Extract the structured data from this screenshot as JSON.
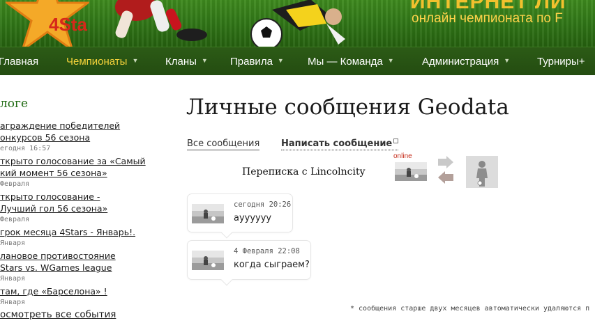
{
  "banner": {
    "star_text": "4Sta",
    "brand_text": "ИНТЕРНЕТ ЛИ",
    "tagline": "онлайн чемпионата по F"
  },
  "nav": {
    "items": [
      {
        "label": "Главная",
        "has_caret": false,
        "active": false
      },
      {
        "label": "Чемпионаты",
        "has_caret": true,
        "active": true
      },
      {
        "label": "Кланы",
        "has_caret": true,
        "active": false
      },
      {
        "label": "Правила",
        "has_caret": true,
        "active": false
      },
      {
        "label": "Мы — Команда",
        "has_caret": true,
        "active": false
      },
      {
        "label": "Администрация",
        "has_caret": true,
        "active": false
      },
      {
        "label": "Турниры+",
        "has_caret": false,
        "active": false
      }
    ]
  },
  "sidebar": {
    "title": "логе",
    "items": [
      {
        "lines": [
          "аграждение победителей",
          "онкурсов 56 сезона"
        ],
        "date": "егодня 16:57"
      },
      {
        "lines": [
          "ткрыто голосование за «Самый",
          "кий момент 56 сезона»"
        ],
        "date": "Февраля"
      },
      {
        "lines": [
          "ткрыто голосование -",
          "Лучший гол 56 сезона»"
        ],
        "date": "Февраля"
      },
      {
        "lines": [
          "грок месяца 4Stars - Январь!."
        ],
        "date": "Января"
      },
      {
        "lines": [
          "лановое противостояние",
          "Stars vs. WGames league"
        ],
        "date": "Января"
      },
      {
        "lines": [
          "там, где «Барселона» !"
        ],
        "date": "Января"
      }
    ],
    "all_events": "осмотреть все события"
  },
  "main": {
    "title": "Личные сообщения Geodata",
    "tab_all": "Все сообщения",
    "tab_write": "Написать сообщение",
    "conversation_title": "Переписка с Lincolncity",
    "online_label": "online",
    "messages": [
      {
        "time": "сегодня 20:26",
        "text": "ayyyyyy"
      },
      {
        "time": "4 Февраля 22:08",
        "text": "когда сыграем?"
      }
    ],
    "footnote": "* сообщения старше двух месяцев автоматически удаляются п"
  },
  "colors": {
    "nav_bg": "#244c11",
    "nav_active": "#f5d33a",
    "sidebar_title": "#1f6a12",
    "online_red": "#c62e1c"
  }
}
